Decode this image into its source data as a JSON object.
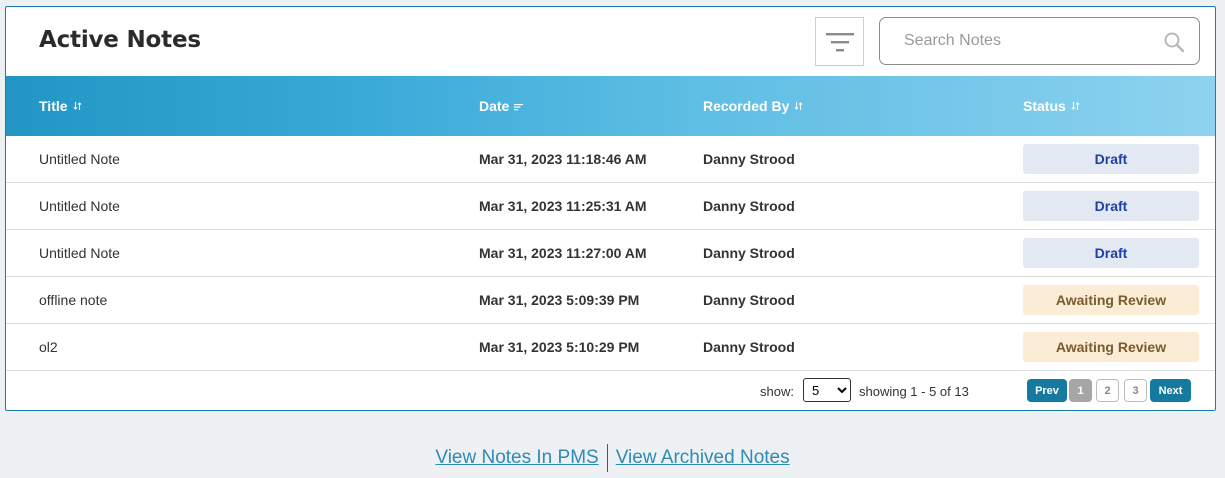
{
  "header": {
    "title": "Active Notes",
    "search_placeholder": "Search Notes"
  },
  "table": {
    "columns": [
      {
        "label": "Title",
        "sort": "sortable"
      },
      {
        "label": "Date",
        "sort": "sorted"
      },
      {
        "label": "Recorded By",
        "sort": "sortable"
      },
      {
        "label": "Status",
        "sort": "sortable"
      }
    ],
    "rows": [
      {
        "title": "Untitled Note",
        "date": "Mar 31, 2023 11:18:46 AM",
        "recorded_by": "Danny Strood",
        "status": "Draft"
      },
      {
        "title": "Untitled Note",
        "date": "Mar 31, 2023 11:25:31 AM",
        "recorded_by": "Danny Strood",
        "status": "Draft"
      },
      {
        "title": "Untitled Note",
        "date": "Mar 31, 2023 11:27:00 AM",
        "recorded_by": "Danny Strood",
        "status": "Draft"
      },
      {
        "title": "offline note",
        "date": "Mar 31, 2023 5:09:39 PM",
        "recorded_by": "Danny Strood",
        "status": "Awaiting Review"
      },
      {
        "title": "ol2",
        "date": "Mar 31, 2023 5:10:29 PM",
        "recorded_by": "Danny Strood",
        "status": "Awaiting Review"
      }
    ]
  },
  "pagination": {
    "show_label": "show:",
    "page_size": "5",
    "showing_text": "showing 1 - 5 of 13",
    "prev_label": "Prev",
    "next_label": "Next",
    "pages": [
      "1",
      "2",
      "3"
    ],
    "current_page": "1"
  },
  "footer": {
    "pms_link": "View Notes In PMS",
    "archived_link": "View Archived Notes"
  },
  "colors": {
    "header_gradient_start": "#2196c4",
    "header_gradient_end": "#8ed3ef",
    "draft_bg": "#e3e9f2",
    "draft_text": "#1f3fa8",
    "review_bg": "#fbedd5",
    "review_text": "#7a5a2e",
    "accent": "#1579a0",
    "link": "#2f8ab4"
  },
  "icons": {
    "filter": "filter-icon",
    "search": "search-icon",
    "sort": "sort-icon"
  }
}
